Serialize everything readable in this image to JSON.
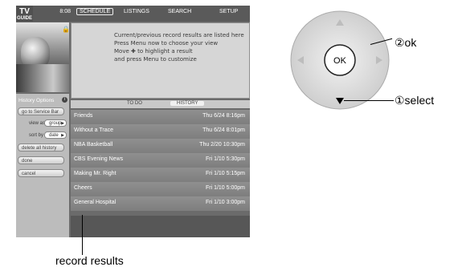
{
  "screen": {
    "logo": {
      "line1": "TV",
      "line2": "GUIDE"
    },
    "clock": "8:08",
    "nav": [
      "SCHEDULE",
      "LISTINGS",
      "SEARCH",
      "SETUP"
    ],
    "info_lines": [
      "Current/previous record results are listed here",
      "Press Menu now to choose your view",
      "Move ✚ to highlight a result",
      "and press Menu to customize"
    ],
    "sidebar": {
      "title": "History Options",
      "go_service_bar": "go to Service Bar",
      "view_as_label": "view as",
      "view_as_value": "group",
      "sort_by_label": "sort by",
      "sort_by_value": "date",
      "delete_all": "delete all history",
      "done": "done",
      "cancel": "cancel"
    },
    "tabs": [
      "TO DO",
      "HISTORY"
    ],
    "records": [
      {
        "title": "Friends",
        "time": "Thu 6/24 8:16pm"
      },
      {
        "title": "Without a Trace",
        "time": "Thu 6/24 8:01pm"
      },
      {
        "title": "NBA Basketball",
        "time": "Thu 2/20 10:30pm"
      },
      {
        "title": "CBS Evening News",
        "time": "Fri 1/10 5:30pm"
      },
      {
        "title": "Making Mr. Right",
        "time": "Fri 1/10 5:15pm"
      },
      {
        "title": "Cheers",
        "time": "Fri 1/10 5:00pm"
      },
      {
        "title": "General Hospital",
        "time": "Fri 1/10 3:00pm"
      }
    ]
  },
  "annotations": {
    "record_results": "record results",
    "ok": "②ok",
    "select": "①select"
  },
  "remote": {
    "ok_button": "OK"
  }
}
